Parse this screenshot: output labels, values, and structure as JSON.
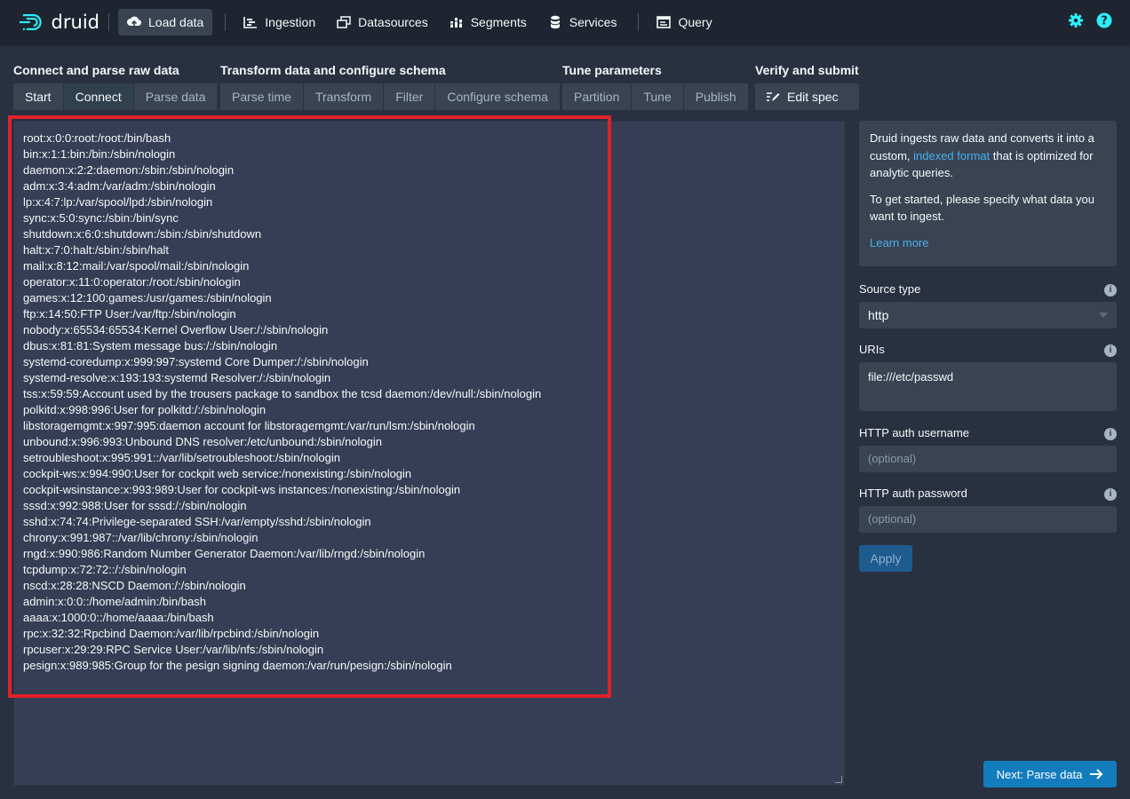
{
  "nav": {
    "logo_text": "druid",
    "load_data": "Load data",
    "ingestion": "Ingestion",
    "datasources": "Datasources",
    "segments": "Segments",
    "services": "Services",
    "query": "Query"
  },
  "steps": {
    "connect_group": "Connect and parse raw data",
    "transform_group": "Transform data and configure schema",
    "tune_group": "Tune parameters",
    "verify_group": "Verify and submit",
    "tabs": {
      "start": "Start",
      "connect": "Connect",
      "parse_data": "Parse data",
      "parse_time": "Parse time",
      "transform": "Transform",
      "filter": "Filter",
      "configure_schema": "Configure schema",
      "partition": "Partition",
      "tune": "Tune",
      "publish": "Publish",
      "edit_spec": "Edit spec"
    }
  },
  "raw_lines": [
    "root:x:0:0:root:/root:/bin/bash",
    "bin:x:1:1:bin:/bin:/sbin/nologin",
    "daemon:x:2:2:daemon:/sbin:/sbin/nologin",
    "adm:x:3:4:adm:/var/adm:/sbin/nologin",
    "lp:x:4:7:lp:/var/spool/lpd:/sbin/nologin",
    "sync:x:5:0:sync:/sbin:/bin/sync",
    "shutdown:x:6:0:shutdown:/sbin:/sbin/shutdown",
    "halt:x:7:0:halt:/sbin:/sbin/halt",
    "mail:x:8:12:mail:/var/spool/mail:/sbin/nologin",
    "operator:x:11:0:operator:/root:/sbin/nologin",
    "games:x:12:100:games:/usr/games:/sbin/nologin",
    "ftp:x:14:50:FTP User:/var/ftp:/sbin/nologin",
    "nobody:x:65534:65534:Kernel Overflow User:/:/sbin/nologin",
    "dbus:x:81:81:System message bus:/:/sbin/nologin",
    "systemd-coredump:x:999:997:systemd Core Dumper:/:/sbin/nologin",
    "systemd-resolve:x:193:193:systemd Resolver:/:/sbin/nologin",
    "tss:x:59:59:Account used by the trousers package to sandbox the tcsd daemon:/dev/null:/sbin/nologin",
    "polkitd:x:998:996:User for polkitd:/:/sbin/nologin",
    "libstoragemgmt:x:997:995:daemon account for libstoragemgmt:/var/run/lsm:/sbin/nologin",
    "unbound:x:996:993:Unbound DNS resolver:/etc/unbound:/sbin/nologin",
    "setroubleshoot:x:995:991::/var/lib/setroubleshoot:/sbin/nologin",
    "cockpit-ws:x:994:990:User for cockpit web service:/nonexisting:/sbin/nologin",
    "cockpit-wsinstance:x:993:989:User for cockpit-ws instances:/nonexisting:/sbin/nologin",
    "sssd:x:992:988:User for sssd:/:/sbin/nologin",
    "sshd:x:74:74:Privilege-separated SSH:/var/empty/sshd:/sbin/nologin",
    "chrony:x:991:987::/var/lib/chrony:/sbin/nologin",
    "rngd:x:990:986:Random Number Generator Daemon:/var/lib/rngd:/sbin/nologin",
    "tcpdump:x:72:72::/:/sbin/nologin",
    "nscd:x:28:28:NSCD Daemon:/:/sbin/nologin",
    "admin:x:0:0::/home/admin:/bin/bash",
    "aaaa:x:1000:0::/home/aaaa:/bin/bash",
    "rpc:x:32:32:Rpcbind Daemon:/var/lib/rpcbind:/sbin/nologin",
    "rpcuser:x:29:29:RPC Service User:/var/lib/nfs:/sbin/nologin",
    "pesign:x:989:985:Group for the pesign signing daemon:/var/run/pesign:/sbin/nologin"
  ],
  "info": {
    "p1_before": "Druid ingests raw data and converts it into a custom, ",
    "p1_link": "indexed format",
    "p1_after": " that is optimized for analytic queries.",
    "p2": "To get started, please specify what data you want to ingest.",
    "learn_more": "Learn more"
  },
  "form": {
    "source_type_label": "Source type",
    "source_type_value": "http",
    "uris_label": "URIs",
    "uris_value": "file:///etc/passwd",
    "auth_user_label": "HTTP auth username",
    "auth_user_placeholder": "(optional)",
    "auth_pass_label": "HTTP auth password",
    "auth_pass_placeholder": "(optional)",
    "apply": "Apply",
    "info_glyph": "i"
  },
  "next_button": "Next: Parse data",
  "colors": {
    "accent": "#137cbd",
    "highlight": "#e0222a",
    "link": "#48aff0"
  }
}
